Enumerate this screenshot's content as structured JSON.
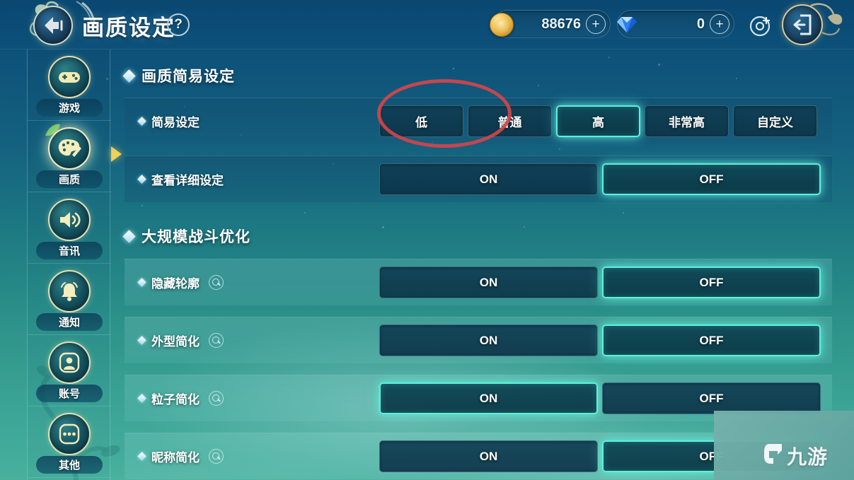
{
  "header": {
    "title": "画质设定",
    "help_label": "?",
    "back_icon": "back-arrow-icon",
    "currencies": [
      {
        "icon": "gold-coin-icon",
        "value": "88676",
        "plus_label": "+"
      },
      {
        "icon": "diamond-icon",
        "value": "0",
        "plus_label": "+"
      }
    ],
    "target_icon": "target-add-icon",
    "exit_icon": "exit-door-icon"
  },
  "sidebar": {
    "items": [
      {
        "label": "游戏",
        "icon": "gamepad-icon",
        "active": false
      },
      {
        "label": "画质",
        "icon": "palette-icon",
        "active": true
      },
      {
        "label": "音讯",
        "icon": "speaker-icon",
        "active": false
      },
      {
        "label": "通知",
        "icon": "bell-icon",
        "active": false
      },
      {
        "label": "账号",
        "icon": "person-icon",
        "active": false
      },
      {
        "label": "其他",
        "icon": "ellipsis-icon",
        "active": false
      }
    ]
  },
  "main": {
    "sections": [
      {
        "title": "画质简易设定",
        "rows": [
          {
            "label": "简易设定",
            "has_info": false,
            "type": "preset",
            "options": [
              "低",
              "普通",
              "高",
              "非常高",
              "自定义"
            ],
            "selected": "高"
          },
          {
            "label": "查看详细设定",
            "has_info": false,
            "type": "toggle",
            "options": [
              "ON",
              "OFF"
            ],
            "selected": "OFF"
          }
        ]
      },
      {
        "title": "大规模战斗优化",
        "rows": [
          {
            "label": "隐藏轮廓",
            "has_info": true,
            "type": "toggle",
            "options": [
              "ON",
              "OFF"
            ],
            "selected": "OFF"
          },
          {
            "label": "外型简化",
            "has_info": true,
            "type": "toggle",
            "options": [
              "ON",
              "OFF"
            ],
            "selected": "OFF"
          },
          {
            "label": "粒子简化",
            "has_info": true,
            "type": "toggle",
            "options": [
              "ON",
              "OFF"
            ],
            "selected": "ON"
          },
          {
            "label": "昵称简化",
            "has_info": true,
            "type": "toggle",
            "options": [
              "ON",
              "OFF"
            ],
            "selected": "OFF"
          }
        ]
      }
    ]
  },
  "annotation": {
    "shape": "ellipse",
    "color": "#d4444a",
    "covers": [
      "低",
      "普通"
    ]
  },
  "watermark": {
    "text": "九游"
  },
  "colors": {
    "accent_cyan": "#5ef0db",
    "gold": "#e8b441",
    "arrow_yellow": "#f0cf5a",
    "annotation_red": "#d4444a"
  }
}
